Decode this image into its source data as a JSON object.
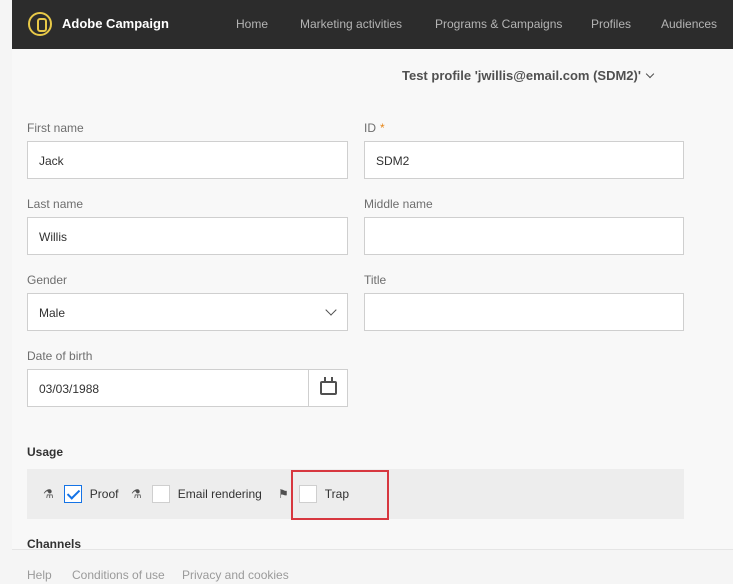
{
  "topbar": {
    "app_name": "Adobe Campaign",
    "nav": [
      "Home",
      "Marketing activities",
      "Programs & Campaigns",
      "Profiles",
      "Audiences"
    ]
  },
  "header": {
    "title": "Test profile 'jwillis@email.com (SDM2)'"
  },
  "form": {
    "first_name": {
      "label": "First name",
      "value": "Jack"
    },
    "id": {
      "label": "ID",
      "required_mark": "*",
      "value": "SDM2"
    },
    "last_name": {
      "label": "Last name",
      "value": "Willis"
    },
    "middle_name": {
      "label": "Middle name",
      "value": ""
    },
    "gender": {
      "label": "Gender",
      "value": "Male"
    },
    "title": {
      "label": "Title",
      "value": ""
    },
    "dob": {
      "label": "Date of birth",
      "value": "03/03/1988"
    }
  },
  "usage": {
    "title": "Usage",
    "proof": {
      "label": "Proof",
      "checked": true
    },
    "email_rendering": {
      "label": "Email rendering",
      "checked": false
    },
    "trap": {
      "label": "Trap",
      "checked": false
    }
  },
  "channels": {
    "title": "Channels"
  },
  "footer": {
    "links": [
      "Help",
      "Conditions of use",
      "Privacy and cookies"
    ]
  },
  "colors": {
    "highlight": "#d7373f",
    "checkbox_accent": "#1473e6",
    "topbar": "#2c2c2c"
  }
}
